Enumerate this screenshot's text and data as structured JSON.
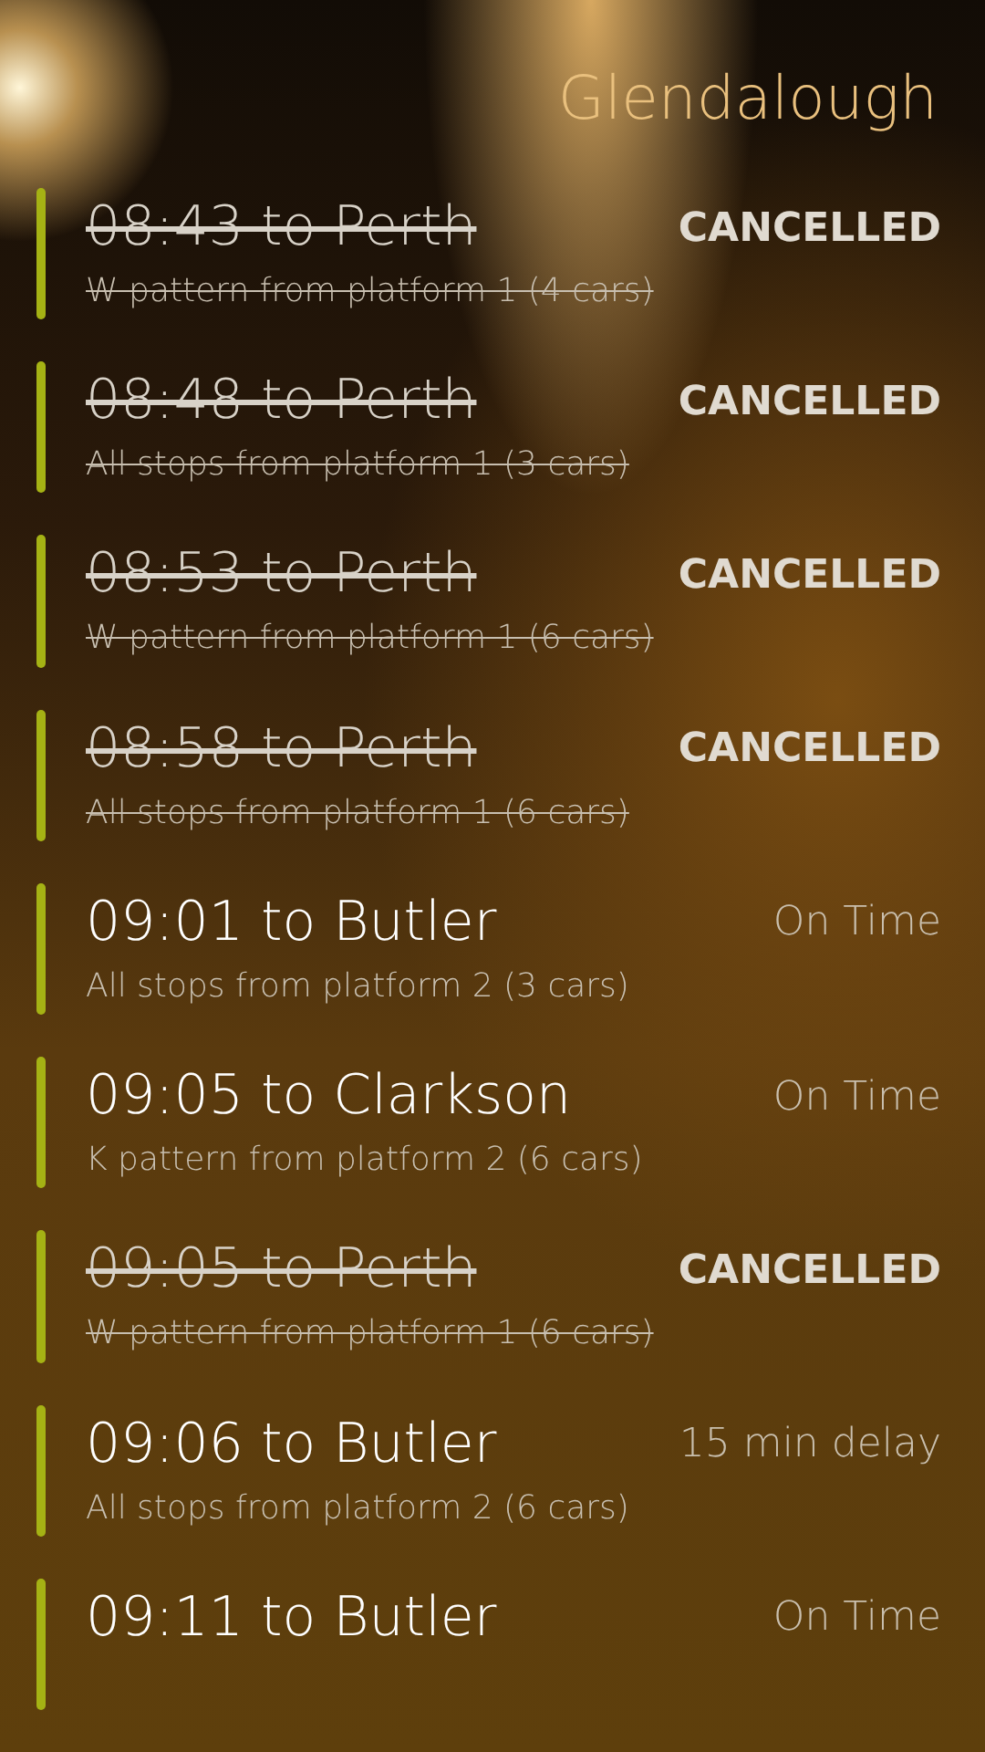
{
  "header": {
    "title": "Glendalough"
  },
  "departures": [
    {
      "title": "08:43 to Perth",
      "detail": "W pattern from platform 1 (4 cars)",
      "status": "CANCELLED",
      "cancelled": true
    },
    {
      "title": "08:48 to Perth",
      "detail": "All stops from platform 1 (3 cars)",
      "status": "CANCELLED",
      "cancelled": true
    },
    {
      "title": "08:53 to Perth",
      "detail": "W pattern from platform 1 (6 cars)",
      "status": "CANCELLED",
      "cancelled": true
    },
    {
      "title": "08:58 to Perth",
      "detail": "All stops from platform 1 (6 cars)",
      "status": "CANCELLED",
      "cancelled": true
    },
    {
      "title": "09:01 to Butler",
      "detail": "All stops from platform 2 (3 cars)",
      "status": "On Time",
      "cancelled": false
    },
    {
      "title": "09:05 to Clarkson",
      "detail": "K pattern from platform 2 (6 cars)",
      "status": "On Time",
      "cancelled": false
    },
    {
      "title": "09:05 to Perth",
      "detail": "W pattern from platform 1 (6 cars)",
      "status": "CANCELLED",
      "cancelled": true
    },
    {
      "title": "09:06 to Butler",
      "detail": "All stops from platform 2 (6 cars)",
      "status": "15 min delay",
      "cancelled": false
    },
    {
      "title": "09:11 to Butler",
      "status": "On Time",
      "cancelled": false
    }
  ]
}
